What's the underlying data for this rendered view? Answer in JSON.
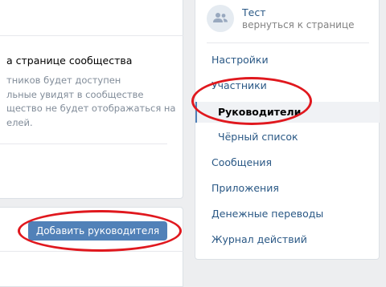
{
  "main": {
    "title": "а странице сообщества",
    "description": "тников будет доступен\nльные увидят в сообществе\nщество не будет отображаться на\nелей."
  },
  "actions": {
    "add_manager_button": "Добавить руководителя"
  },
  "sidebar": {
    "group_name": "Тест",
    "back_link": "вернуться к странице",
    "avatar_icon": "group-people-icon",
    "items": [
      {
        "label": "Настройки"
      },
      {
        "label": "Участники"
      },
      {
        "label": "Руководители",
        "selected": true
      },
      {
        "label": "Чёрный список"
      },
      {
        "label": "Сообщения"
      },
      {
        "label": "Приложения"
      },
      {
        "label": "Денежные переводы"
      },
      {
        "label": "Журнал действий"
      }
    ]
  },
  "colors": {
    "accent": "#5181b8",
    "link": "#2a5885",
    "annotation": "#e0181e",
    "background": "#edeef0"
  }
}
